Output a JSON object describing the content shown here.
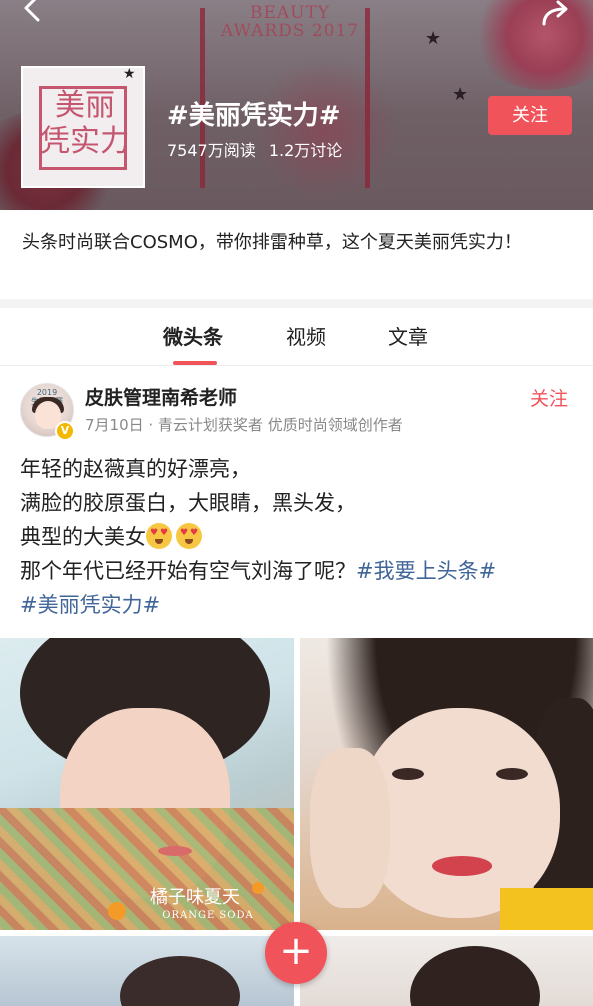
{
  "header": {
    "topic_title": "#美丽凭实力#",
    "reads": "7547万阅读",
    "discussions": "1.2万讨论",
    "follow_label": "关注",
    "back_icon": "back-arrow-icon",
    "share_icon": "share-arrow-icon",
    "accent_color": "#f0545a"
  },
  "intro": {
    "text": "头条时尚联合COSMO，带你排雷种草，这个夏天美丽凭实力！"
  },
  "tabs": [
    {
      "label": "微头条",
      "active": true
    },
    {
      "label": "视频",
      "active": false
    },
    {
      "label": "文章",
      "active": false
    }
  ],
  "post": {
    "author": "皮肤管理南希老师",
    "meta": "7月10日 · 青云计划获奖者 优质时尚领域创作者",
    "follow_label": "关注",
    "verified_badge": "V",
    "lines": {
      "l1": "年轻的赵薇真的好漂亮，",
      "l2": "满脸的胶原蛋白，大眼睛，黑头发，",
      "l3": "典型的大美女",
      "l4_text": "那个年代已经开始有空气刘海了呢？",
      "l4_tag": "#我要上头条#",
      "l5_tag": "#美丽凭实力#"
    },
    "photo1_caption": "橘子味夏天",
    "photo1_subcaption": "ORANGE SODA",
    "hashtag_color": "#406599"
  },
  "fab": {
    "icon": "plus-icon",
    "symbol": "+"
  }
}
